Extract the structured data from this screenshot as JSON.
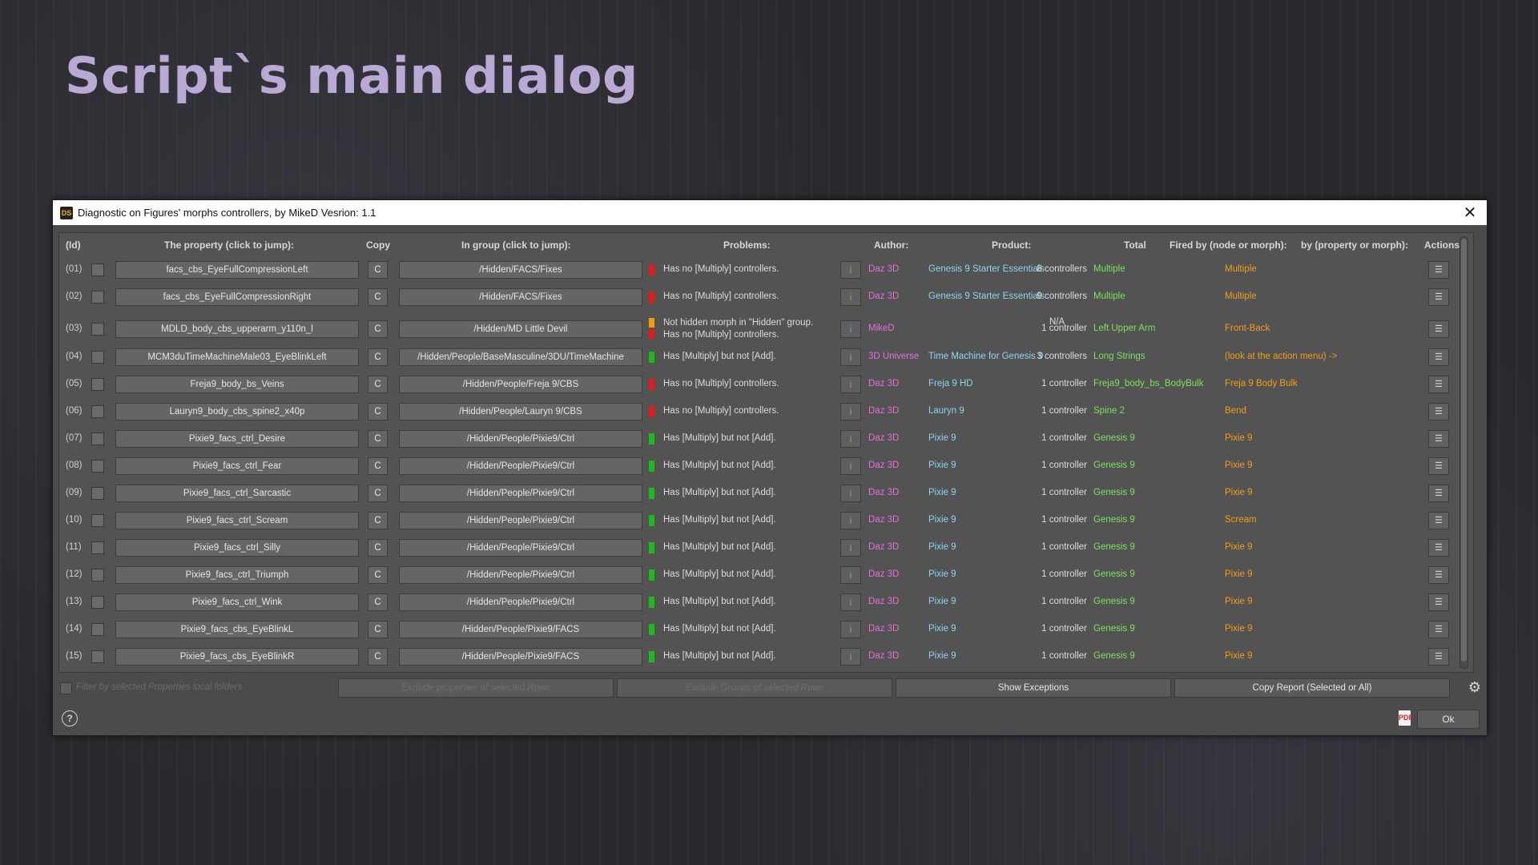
{
  "slide": {
    "title": "Script`s main dialog"
  },
  "dialog": {
    "app_icon": "DS",
    "title": "Diagnostic on Figures' morphs controllers, by MikeD Vesrion: 1.1",
    "close_glyph": "✕"
  },
  "columns": {
    "id": "(Id)",
    "property": "The property (click to jump):",
    "copy": "Copy",
    "group": "In group (click to jump):",
    "problems": "Problems:",
    "author": "Author:",
    "product": "Product:",
    "total": "Total",
    "fired": "Fired by (node or morph):",
    "byprop": "by (property or morph):",
    "actions": "Actions:"
  },
  "colors": {
    "red": "#e21b1b",
    "orange": "#f39a12",
    "green": "#1fb81f",
    "author": "#e26fdc",
    "product": "#8fd4ef",
    "fired": "#7fe05e",
    "byprop": "#f39c1a"
  },
  "rows": [
    {
      "id": "(01)",
      "property": "facs_cbs_EyeFullCompressionLeft",
      "copy": "C",
      "group": "/Hidden/FACS/Fixes",
      "status": [
        "red"
      ],
      "problems": [
        "Has no [Multiply] controllers."
      ],
      "info": "i",
      "author": "Daz 3D",
      "product": "Genesis 9 Starter Essentials",
      "total": "8 controllers",
      "fired": "Multiple",
      "byprop": "Multiple",
      "action_icon": "list-icon"
    },
    {
      "id": "(02)",
      "property": "facs_cbs_EyeFullCompressionRight",
      "copy": "C",
      "group": "/Hidden/FACS/Fixes",
      "status": [
        "red"
      ],
      "problems": [
        "Has no [Multiply] controllers."
      ],
      "info": "i",
      "author": "Daz 3D",
      "product": "Genesis 9 Starter Essentials",
      "total": "9 controllers",
      "fired": "Multiple",
      "byprop": "Multiple",
      "action_icon": "list-icon"
    },
    {
      "id": "(03)",
      "property": "MDLD_body_cbs_upperarm_y110n_l",
      "copy": "C",
      "group": "/Hidden/MD Little Devil",
      "status": [
        "orange",
        "red"
      ],
      "problems": [
        "Not hidden morph in \"Hidden\" group.",
        "Has no [Multiply] controllers."
      ],
      "info": "i",
      "author": "MikeD",
      "product": "N/A",
      "total": "1 controller",
      "fired": "Left Upper Arm",
      "byprop": "Front-Back",
      "action_icon": "list-icon"
    },
    {
      "id": "(04)",
      "property": "MCM3duTimeMachineMale03_EyeBlinkLeft",
      "copy": "C",
      "group": "/Hidden/People/BaseMasculine/3DU/TimeMachine",
      "status": [
        "green"
      ],
      "problems": [
        "Has [Multiply] but not [Add]."
      ],
      "info": "i",
      "author": "3D Universe",
      "product": "Time Machine for Genesis 9",
      "total": "3 controllers",
      "fired": "Long Strings",
      "byprop": "(look at the action menu) ->",
      "action_icon": "list-icon"
    },
    {
      "id": "(05)",
      "property": "Freja9_body_bs_Veins",
      "copy": "C",
      "group": "/Hidden/People/Freja 9/CBS",
      "status": [
        "red"
      ],
      "problems": [
        "Has no [Multiply] controllers."
      ],
      "info": "i",
      "author": "Daz 3D",
      "product": "Freja 9 HD",
      "total": "1 controller",
      "fired": "Freja9_body_bs_BodyBulk",
      "byprop": "Freja 9 Body Bulk",
      "action_icon": "list-icon"
    },
    {
      "id": "(06)",
      "property": "Lauryn9_body_cbs_spine2_x40p",
      "copy": "C",
      "group": "/Hidden/People/Lauryn 9/CBS",
      "status": [
        "red"
      ],
      "problems": [
        "Has no [Multiply] controllers."
      ],
      "info": "i",
      "author": "Daz 3D",
      "product": "Lauryn 9",
      "total": "1 controller",
      "fired": "Spine 2",
      "byprop": "Bend",
      "action_icon": "list-icon"
    },
    {
      "id": "(07)",
      "property": "Pixie9_facs_ctrl_Desire",
      "copy": "C",
      "group": "/Hidden/People/Pixie9/Ctrl",
      "status": [
        "green"
      ],
      "problems": [
        "Has [Multiply] but not [Add]."
      ],
      "info": "i",
      "author": "Daz 3D",
      "product": "Pixie 9",
      "total": "1 controller",
      "fired": "Genesis 9",
      "byprop": "Pixie 9",
      "action_icon": "list-icon"
    },
    {
      "id": "(08)",
      "property": "Pixie9_facs_ctrl_Fear",
      "copy": "C",
      "group": "/Hidden/People/Pixie9/Ctrl",
      "status": [
        "green"
      ],
      "problems": [
        "Has [Multiply] but not [Add]."
      ],
      "info": "i",
      "author": "Daz 3D",
      "product": "Pixie 9",
      "total": "1 controller",
      "fired": "Genesis 9",
      "byprop": "Pixie 9",
      "action_icon": "list-icon"
    },
    {
      "id": "(09)",
      "property": "Pixie9_facs_ctrl_Sarcastic",
      "copy": "C",
      "group": "/Hidden/People/Pixie9/Ctrl",
      "status": [
        "green"
      ],
      "problems": [
        "Has [Multiply] but not [Add]."
      ],
      "info": "i",
      "author": "Daz 3D",
      "product": "Pixie 9",
      "total": "1 controller",
      "fired": "Genesis 9",
      "byprop": "Pixie 9",
      "action_icon": "list-icon"
    },
    {
      "id": "(10)",
      "property": "Pixie9_facs_ctrl_Scream",
      "copy": "C",
      "group": "/Hidden/People/Pixie9/Ctrl",
      "status": [
        "green"
      ],
      "problems": [
        "Has [Multiply] but not [Add]."
      ],
      "info": "i",
      "author": "Daz 3D",
      "product": "Pixie 9",
      "total": "1 controller",
      "fired": "Genesis 9",
      "byprop": "Scream",
      "action_icon": "list-icon"
    },
    {
      "id": "(11)",
      "property": "Pixie9_facs_ctrl_Silly",
      "copy": "C",
      "group": "/Hidden/People/Pixie9/Ctrl",
      "status": [
        "green"
      ],
      "problems": [
        "Has [Multiply] but not [Add]."
      ],
      "info": "i",
      "author": "Daz 3D",
      "product": "Pixie 9",
      "total": "1 controller",
      "fired": "Genesis 9",
      "byprop": "Pixie 9",
      "action_icon": "list-icon"
    },
    {
      "id": "(12)",
      "property": "Pixie9_facs_ctrl_Triumph",
      "copy": "C",
      "group": "/Hidden/People/Pixie9/Ctrl",
      "status": [
        "green"
      ],
      "problems": [
        "Has [Multiply] but not [Add]."
      ],
      "info": "i",
      "author": "Daz 3D",
      "product": "Pixie 9",
      "total": "1 controller",
      "fired": "Genesis 9",
      "byprop": "Pixie 9",
      "action_icon": "list-icon"
    },
    {
      "id": "(13)",
      "property": "Pixie9_facs_ctrl_Wink",
      "copy": "C",
      "group": "/Hidden/People/Pixie9/Ctrl",
      "status": [
        "green"
      ],
      "problems": [
        "Has [Multiply] but not [Add]."
      ],
      "info": "i",
      "author": "Daz 3D",
      "product": "Pixie 9",
      "total": "1 controller",
      "fired": "Genesis 9",
      "byprop": "Pixie 9",
      "action_icon": "list-icon"
    },
    {
      "id": "(14)",
      "property": "Pixie9_facs_cbs_EyeBlinkL",
      "copy": "C",
      "group": "/Hidden/People/Pixie9/FACS",
      "status": [
        "green"
      ],
      "problems": [
        "Has [Multiply] but not [Add]."
      ],
      "info": "i",
      "author": "Daz 3D",
      "product": "Pixie 9",
      "total": "1 controller",
      "fired": "Genesis 9",
      "byprop": "Pixie 9",
      "action_icon": "list-icon"
    },
    {
      "id": "(15)",
      "property": "Pixie9_facs_cbs_EyeBlinkR",
      "copy": "C",
      "group": "/Hidden/People/Pixie9/FACS",
      "status": [
        "green"
      ],
      "problems": [
        "Has [Multiply] but not [Add]."
      ],
      "info": "i",
      "author": "Daz 3D",
      "product": "Pixie 9",
      "total": "1 controller",
      "fired": "Genesis 9",
      "byprop": "Pixie 9",
      "action_icon": "list-icon"
    }
  ],
  "bottom": {
    "filter_label": "Filter by selected Properties local folders",
    "exclude_props": "Exclude properties of selected Rows",
    "exclude_groups": "Exclude Groups of selected Rows",
    "show_exceptions": "Show Exceptions",
    "copy_report": "Copy Report (Selected or All)",
    "gear_icon": "gear-icon"
  },
  "footer": {
    "help_glyph": "?",
    "pdf_glyph": "PDF",
    "ok": "Ok"
  }
}
